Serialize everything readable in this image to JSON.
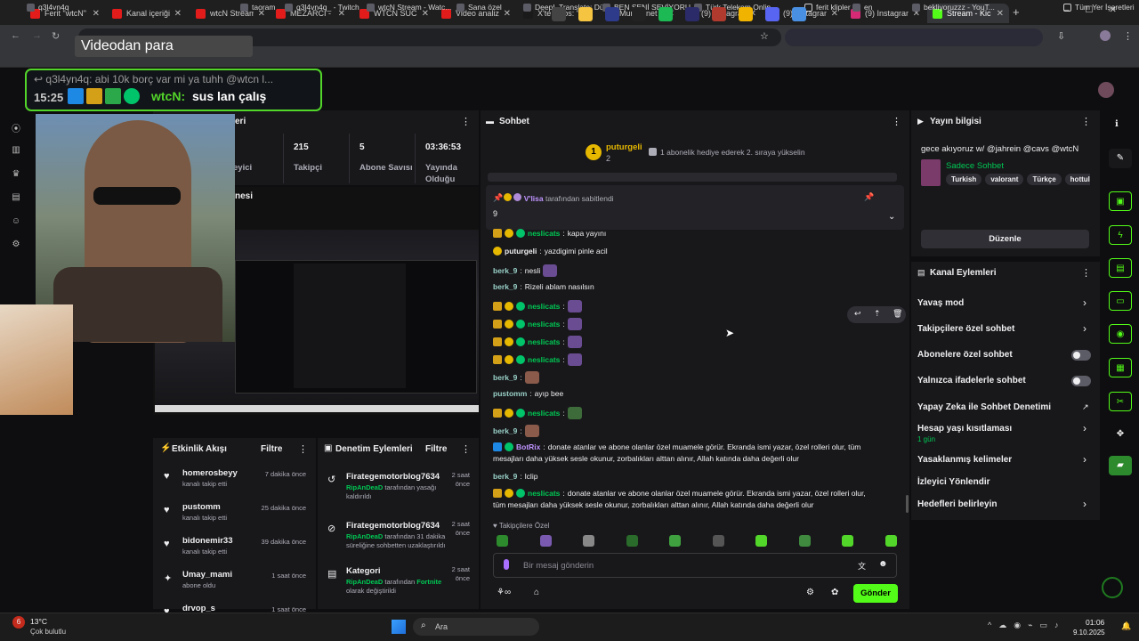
{
  "tabs": [
    {
      "label": "Ferit \"wtcN\"",
      "color": "#e21b1b"
    },
    {
      "label": "Kanal içeriği",
      "color": "#e21b1b"
    },
    {
      "label": "wtcN Stream",
      "color": "#e21b1b"
    },
    {
      "label": "MEZARCI - F",
      "color": "#e21b1b"
    },
    {
      "label": "WTCN SUCC",
      "color": "#e21b1b"
    },
    {
      "label": "Video analiz",
      "color": "#e21b1b"
    },
    {
      "label": "X'te Cabs: \"",
      "color": "#1a1a1a"
    },
    {
      "label": "Mumhanet",
      "color": "#1a1a1a"
    },
    {
      "label": "(9) Instagran",
      "color": "#d62976"
    },
    {
      "label": "(9) Instagran",
      "color": "#d62976"
    },
    {
      "label": "(9) Instagran",
      "color": "#d62976"
    },
    {
      "label": "Stream - Kic",
      "color": "#53fc18"
    }
  ],
  "bookmarks": [
    "q3l4vn4q",
    "",
    "taoram",
    "q3l4vn4q_ - Twitch",
    "wtcN Stream - Watc...",
    "Sana özel",
    "DeepL Translate: Dü...",
    "BEN SENİ SEVİYORU...",
    "Türk Telekom Onlin...",
    "ferit klipler",
    "en",
    "bekliyoruzzz - YouT...",
    "Tüm Yer İşaretleri"
  ],
  "overlay": {
    "video_title": "Videodan para",
    "alert_line1": "q3l4yn4q: abi 10k borç var mi ya tuhh @wtcn l...",
    "alert_time": "15:25",
    "alert_user": "wtcN:",
    "alert_text": "sus lan çalış"
  },
  "stats": {
    "header_partial": "eri",
    "cols": [
      {
        "value": "",
        "label": "eyici"
      },
      {
        "value": "215",
        "label": "Takipçi"
      },
      {
        "value": "5",
        "label": "Abone Savısı"
      },
      {
        "value": "03:36:53",
        "label": "Yayında Olduğu"
      }
    ],
    "preview_partial": "nesi"
  },
  "activity": {
    "title": "Etkinlik Akışı",
    "filter": "Filtre",
    "items": [
      {
        "user": "homerosbeyy",
        "action": "kanalı takip etti",
        "time": "7 dakika önce",
        "icon": "heart-icon"
      },
      {
        "user": "pustomm",
        "action": "kanalı takip etti",
        "time": "25 dakika önce",
        "icon": "heart-icon"
      },
      {
        "user": "bidonemir33",
        "action": "kanalı takip etti",
        "time": "39 dakika önce",
        "icon": "heart-icon"
      },
      {
        "user": "Umay_mami",
        "action": "abone oldu",
        "time": "1 saat önce",
        "icon": "star-icon"
      },
      {
        "user": "drvop_s",
        "action": "",
        "time": "1 saat önce",
        "icon": "heart-icon"
      }
    ]
  },
  "moderation": {
    "title": "Denetim Eylemleri",
    "filter": "Filtre",
    "items": [
      {
        "target": "Firategemotorblog7634",
        "time": "2 saat önce",
        "mod": "RipAnDeaD",
        "text": "tarafından yasağı kaldırıldı"
      },
      {
        "target": "Firategemotorblog7634",
        "time": "2 saat önce",
        "mod": "RipAnDeaD",
        "text": "tarafından 31 dakika süreliğine sohbetten uzaklaştırıldı"
      },
      {
        "target": "Kategori",
        "time": "2 saat önce",
        "mod": "RipAnDeaD",
        "text": "tarafından",
        "extra": "Fortnite",
        "tail": "olarak değiştirildi"
      }
    ]
  },
  "chat": {
    "title": "Sohbet",
    "leader_user": "puturgeli",
    "leader_count": "2",
    "gift_text": "1 abonelik hediye ederek 2. sıraya yükselin",
    "pinned_by_user": "V'lisa",
    "pinned_by_text": "tarafından sabitlendi",
    "pinned_message": "9",
    "messages": [
      {
        "user": "neslicats",
        "text": "kapa yayını",
        "badges": "csv",
        "color": "#00c853"
      },
      {
        "user": "puturgeli",
        "text": "yazdigimi pinle acil",
        "badges": "s",
        "color": "#efeff1"
      },
      {
        "user": "berk_9",
        "text": "nesli",
        "badges": "",
        "color": "#9ad1c8",
        "emote": true
      },
      {
        "user": "berk_9",
        "text": "Rizeli ablam nasılsın",
        "badges": "",
        "color": "#9ad1c8"
      },
      {
        "user": "neslicats",
        "text": "",
        "badges": "csv",
        "color": "#00c853",
        "emote": true
      },
      {
        "user": "neslicats",
        "text": "",
        "badges": "csv",
        "color": "#00c853",
        "emote": true
      },
      {
        "user": "neslicats",
        "text": "",
        "badges": "csv",
        "color": "#00c853",
        "emote": true
      },
      {
        "user": "neslicats",
        "text": "",
        "badges": "csv",
        "color": "#00c853",
        "emote": true
      },
      {
        "user": "berk_9",
        "text": "",
        "badges": "",
        "color": "#9ad1c8",
        "emote": true
      },
      {
        "user": "pustomm",
        "text": "ayıp bee",
        "badges": "",
        "color": "#9ad1c8"
      },
      {
        "user": "neslicats",
        "text": "",
        "badges": "csv",
        "color": "#00c853",
        "emote": true
      },
      {
        "user": "berk_9",
        "text": "",
        "badges": "",
        "color": "#9ad1c8",
        "emote": true
      },
      {
        "user": "BotRix",
        "text": "donate atanlar ve abone olanlar özel muamele görür. Ekranda ismi yazar, özel rolleri olur, tüm",
        "text2": "mesajları daha yüksek sesle okunur, zorbalıkları alttan alınır, Allah katında daha değerli olur",
        "badges": "bv",
        "color": "#bf94ff"
      },
      {
        "user": "berk_9",
        "text": "lclip",
        "badges": "",
        "color": "#9ad1c8"
      },
      {
        "user": "neslicats",
        "text": "donate atanlar ve abone olanlar özel muamele görür. Ekranda ismi yazar, özel rolleri olur,",
        "text2": "tüm mesajları daha yüksek sesle okunur, zorbalıkları alttan alınır, Allah katında daha değerli olur",
        "badges": "csv",
        "color": "#00c853"
      }
    ],
    "followers_only": "Takipçilere Özel",
    "input_placeholder": "Bir mesaj gönderin",
    "send_label": "Gönder"
  },
  "stream_info": {
    "title": "Yayın bilgisi",
    "stream_title": "gece akıyoruz w/ @jahrein @cavs @wtcN",
    "category": "Sadece Sohbet",
    "tags": [
      "Turkish",
      "valorant",
      "Türkçe",
      "hottul"
    ],
    "edit_label": "Düzenle"
  },
  "channel_actions": {
    "title": "Kanal Eylemleri",
    "items": [
      {
        "label": "Yavaş mod",
        "type": "chevron"
      },
      {
        "label": "Takipçilere özel sohbet",
        "type": "chevron"
      },
      {
        "label": "Abonelere özel sohbet",
        "type": "toggle"
      },
      {
        "label": "Yalnızca ifadelerle sohbet",
        "type": "toggle"
      },
      {
        "label": "Yapay Zeka ile Sohbet Denetimi",
        "type": "external"
      },
      {
        "label": "Hesap yaşı kısıtlaması",
        "type": "chevron",
        "sub": "1 gün"
      },
      {
        "label": "Yasaklanmış kelimeler",
        "type": "chevron"
      },
      {
        "label": "İzleyici Yönlendir",
        "type": "none"
      },
      {
        "label": "Hedefleri belirleyin",
        "type": "chevron"
      }
    ]
  },
  "taskbar": {
    "weather_temp": "13°C",
    "weather_desc": "Çok bulutlu",
    "search": "Ara",
    "time": "01:06",
    "date": "9.10.2025",
    "notif": "6"
  }
}
